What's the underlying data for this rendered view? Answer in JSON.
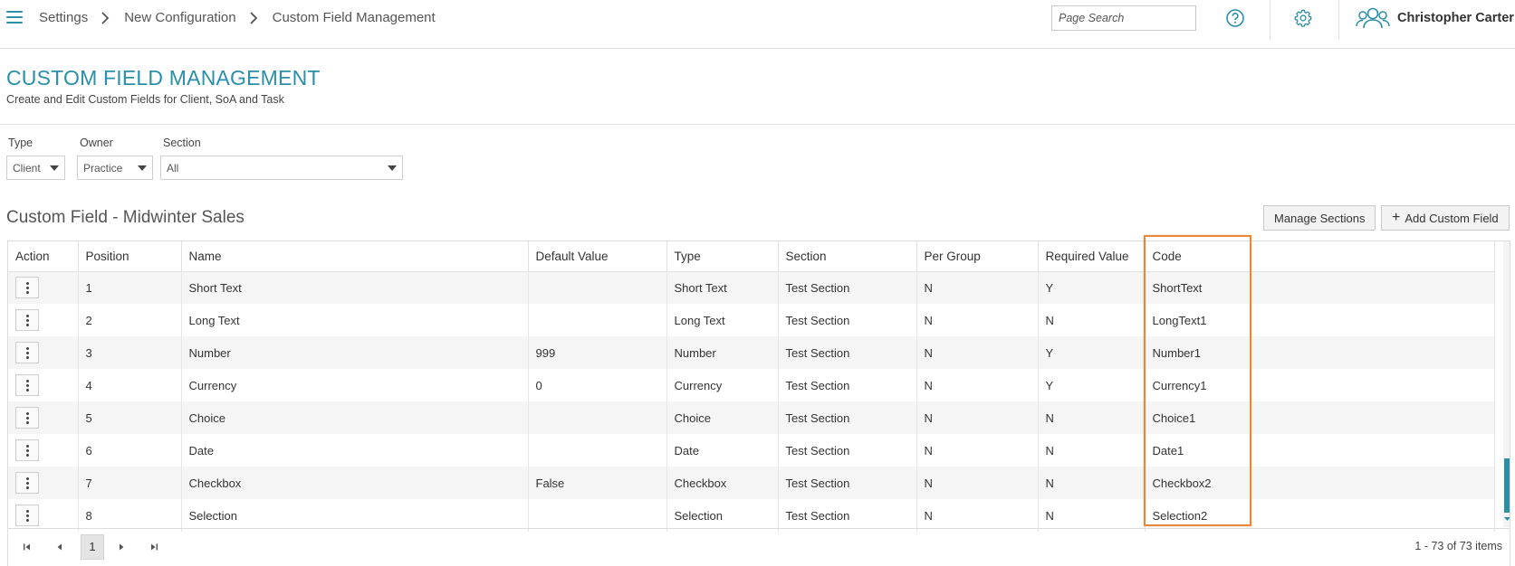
{
  "header": {
    "breadcrumbs": [
      "Settings",
      "New Configuration",
      "Custom Field Management"
    ],
    "search_placeholder": "Page Search",
    "user_name": "Christopher Carter"
  },
  "page": {
    "title": "CUSTOM FIELD MANAGEMENT",
    "subtitle": "Create and Edit Custom Fields for Client, SoA and Task"
  },
  "filters": {
    "type": {
      "label": "Type",
      "value": "Client"
    },
    "owner": {
      "label": "Owner",
      "value": "Practice"
    },
    "section": {
      "label": "Section",
      "value": "All"
    }
  },
  "grid": {
    "title": "Custom Field - Midwinter Sales",
    "manage_sections_label": "Manage Sections",
    "add_custom_field_label": "Add Custom Field",
    "columns": [
      "Action",
      "Position",
      "Name",
      "Default Value",
      "Type",
      "Section",
      "Per Group",
      "Required Value",
      "Code"
    ],
    "rows": [
      {
        "position": "1",
        "name": "Short Text",
        "default": "",
        "type": "Short Text",
        "section": "Test Section",
        "per_group": "N",
        "required": "Y",
        "code": "ShortText"
      },
      {
        "position": "2",
        "name": "Long Text",
        "default": "",
        "type": "Long Text",
        "section": "Test Section",
        "per_group": "N",
        "required": "N",
        "code": "LongText1"
      },
      {
        "position": "3",
        "name": "Number",
        "default": "999",
        "type": "Number",
        "section": "Test Section",
        "per_group": "N",
        "required": "Y",
        "code": "Number1"
      },
      {
        "position": "4",
        "name": "Currency",
        "default": "0",
        "type": "Currency",
        "section": "Test Section",
        "per_group": "N",
        "required": "Y",
        "code": "Currency1"
      },
      {
        "position": "5",
        "name": "Choice",
        "default": "",
        "type": "Choice",
        "section": "Test Section",
        "per_group": "N",
        "required": "N",
        "code": "Choice1"
      },
      {
        "position": "6",
        "name": "Date",
        "default": "",
        "type": "Date",
        "section": "Test Section",
        "per_group": "N",
        "required": "N",
        "code": "Date1"
      },
      {
        "position": "7",
        "name": "Checkbox",
        "default": "False",
        "type": "Checkbox",
        "section": "Test Section",
        "per_group": "N",
        "required": "N",
        "code": "Checkbox2"
      },
      {
        "position": "8",
        "name": "Selection",
        "default": "",
        "type": "Selection",
        "section": "Test Section",
        "per_group": "N",
        "required": "N",
        "code": "Selection2"
      }
    ]
  },
  "pager": {
    "current_page": "1",
    "info": "1 - 73 of 73 items"
  },
  "colors": {
    "accent": "#2a8fa8",
    "highlight": "#e8863a"
  },
  "icons": [
    "hamburger-icon",
    "chevron-right-icon",
    "help-icon",
    "gear-icon",
    "users-icon",
    "chevron-down-icon",
    "kebab-icon",
    "first-page-icon",
    "prev-page-icon",
    "next-page-icon",
    "last-page-icon"
  ]
}
